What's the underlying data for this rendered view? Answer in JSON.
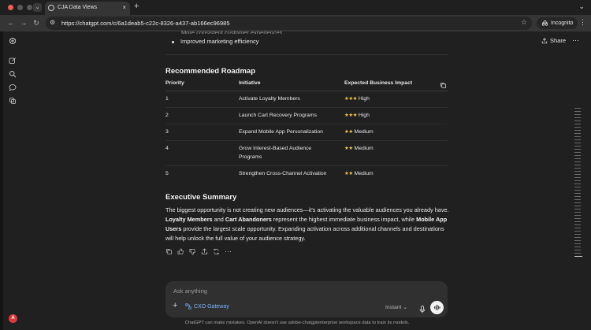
{
  "browser": {
    "tab_title": "CJA Data Views",
    "tab_menu_glyph": "⌄",
    "close_glyph": "×",
    "new_tab_glyph": "+",
    "url": "https://chatgpt.com/c/6a1deab5-c22c-8326-a437-ab166ec96985",
    "profile_label": "Incognito",
    "colors": {
      "close": "#ec5f57"
    }
  },
  "header": {
    "share_label": "Share",
    "more_glyph": "⋯"
  },
  "chat": {
    "partial_line": "More consistent customer experiences",
    "bullet": "Improved marketing efficiency",
    "roadmap": {
      "title": "Recommended Roadmap",
      "columns": [
        "Priority",
        "Initiative",
        "Expected Business Impact"
      ],
      "rows": [
        {
          "priority": "1",
          "initiative": "Activate Loyalty Members",
          "stars": "★★★",
          "impact": "High"
        },
        {
          "priority": "2",
          "initiative": "Launch Cart Recovery Programs",
          "stars": "★★★",
          "impact": "High"
        },
        {
          "priority": "3",
          "initiative": "Expand Mobile App Personalization",
          "stars": "★★",
          "impact": "Medium"
        },
        {
          "priority": "4",
          "initiative": "Grow Interest-Based Audience Programs",
          "stars": "★★",
          "impact": "Medium"
        },
        {
          "priority": "5",
          "initiative": "Strengthen Cross-Channel Activation",
          "stars": "★★",
          "impact": "Medium"
        }
      ]
    },
    "summary": {
      "title": "Executive Summary",
      "p1": "The biggest opportunity is not creating new audiences—it's activating the valuable audiences you already have. ",
      "b1": "Loyalty Members",
      "p2": " and ",
      "b2": "Cart Abandoners",
      "p3": " represent the highest immediate business impact, while ",
      "b3": "Mobile App Users",
      "p4": " provide the largest scale opportunity. Expanding activation across additional channels and destinations will help unlock the full value of your audience strategy."
    },
    "more_actions_glyph": "⋯"
  },
  "composer": {
    "placeholder": "Ask anything",
    "plus_glyph": "+",
    "tool_label": "CXO Gateway",
    "mode_label": "Instant ⌄",
    "colors": {
      "tool": "#7ab4ff"
    }
  },
  "avatar_letter": "A",
  "footer": "ChatGPT can make mistakes. OpenAI doesn't use adobe-chatgptenterprise workspace data to train its models."
}
